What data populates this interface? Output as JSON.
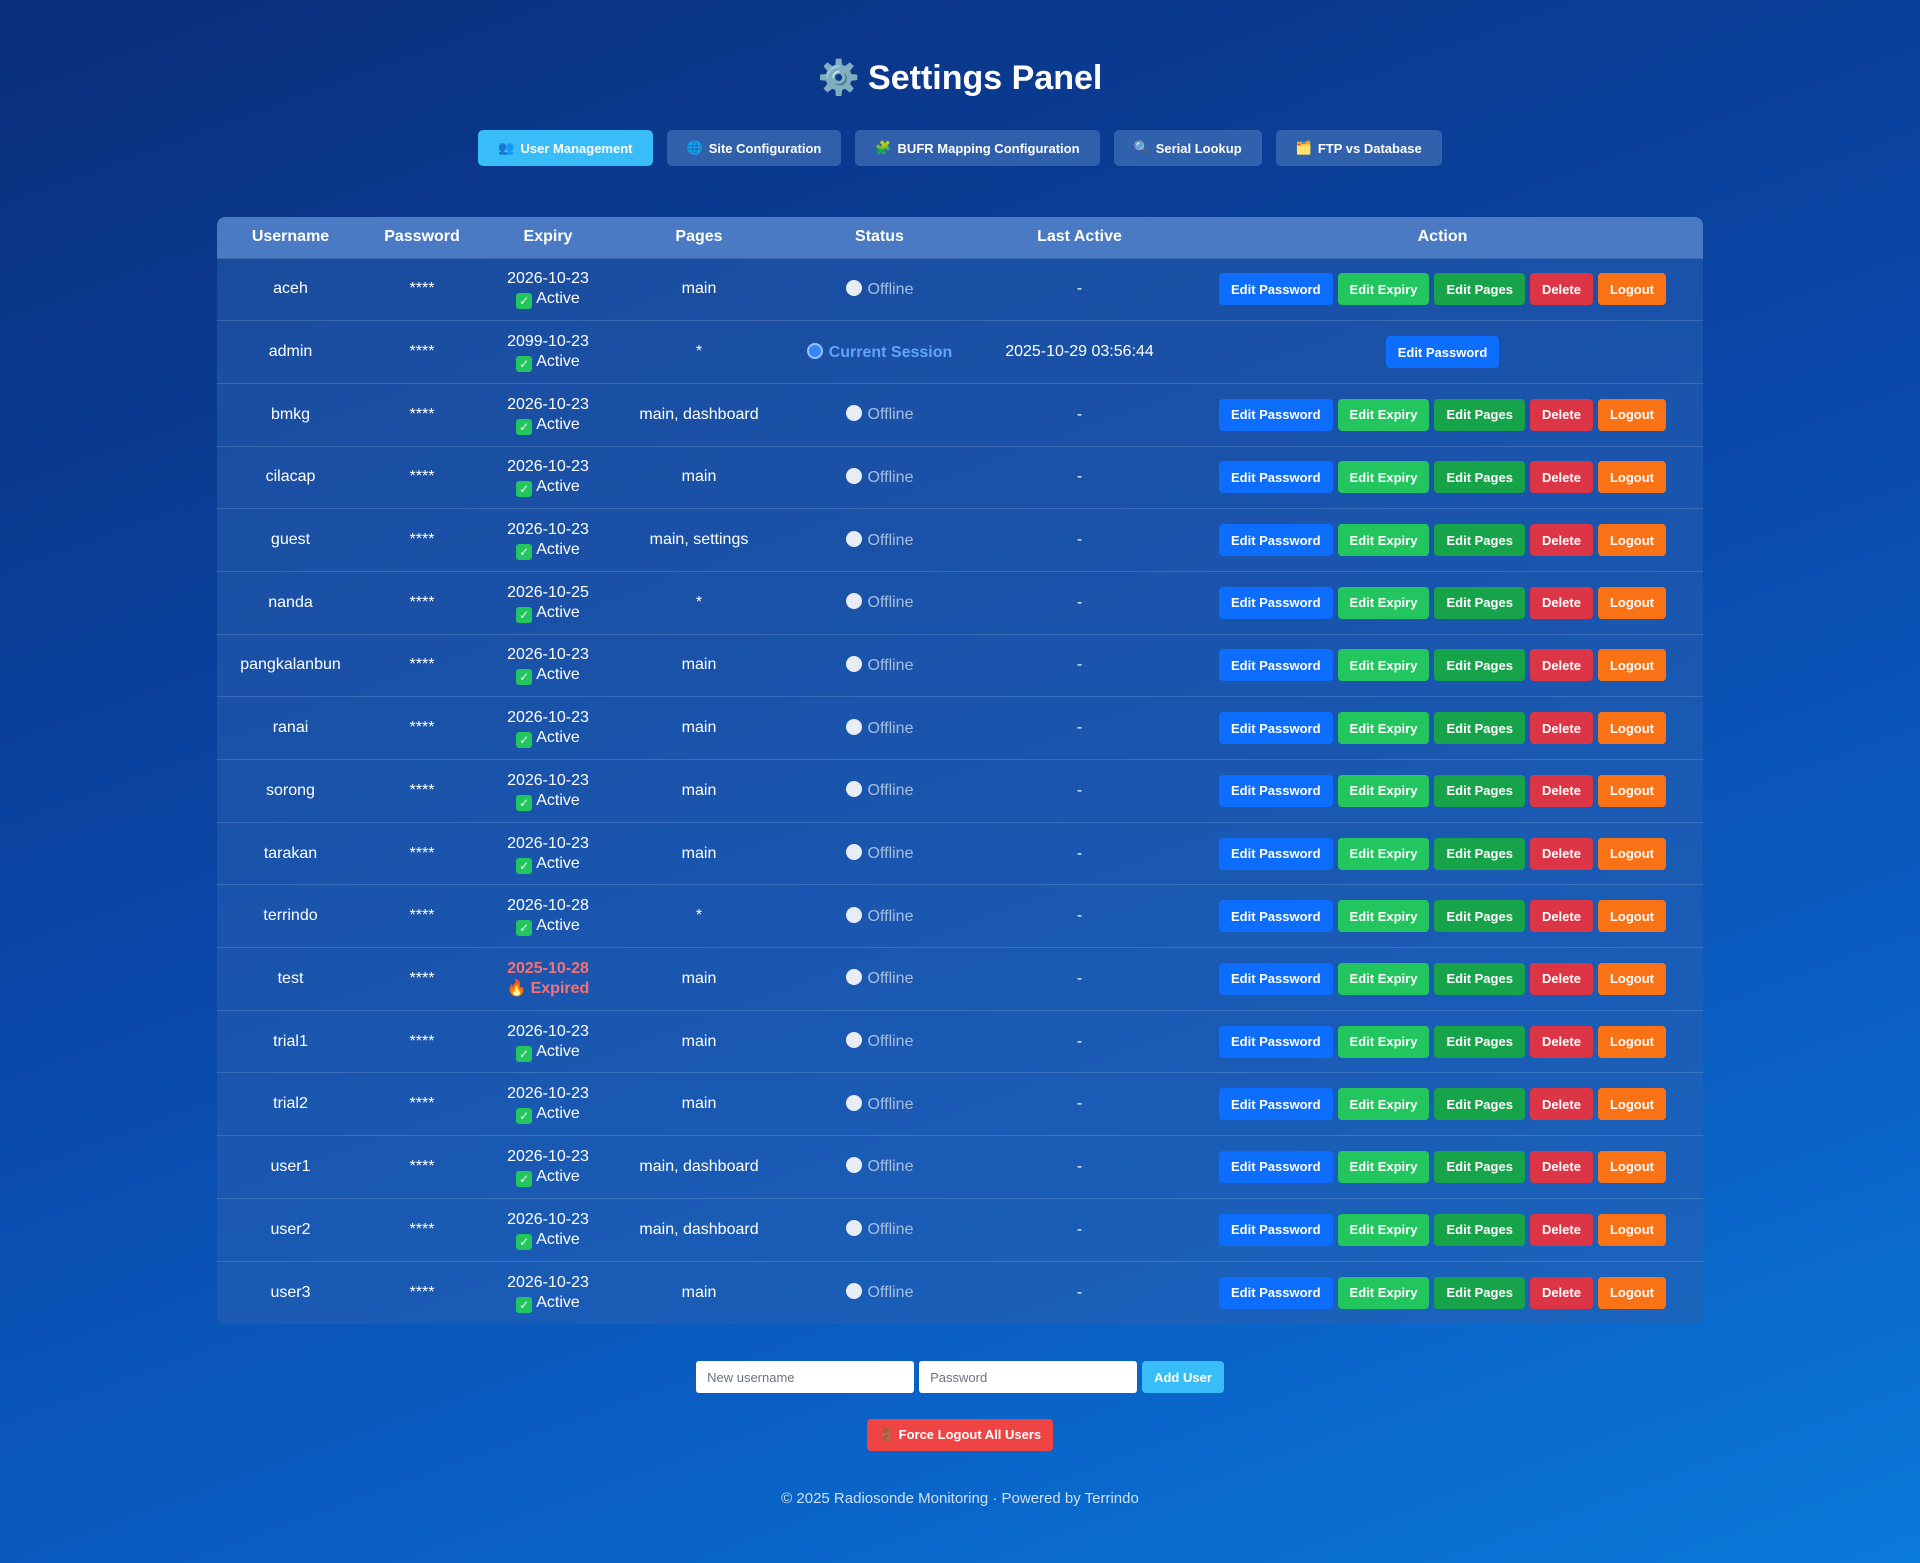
{
  "title": "Settings Panel",
  "title_icon": "gear-icon",
  "tabs": [
    {
      "label": "User Management",
      "icon": "👥",
      "icon_name": "users-icon"
    },
    {
      "label": "Site Configuration",
      "icon": "🌐",
      "icon_name": "globe-icon"
    },
    {
      "label": "BUFR Mapping Configuration",
      "icon": "🧩",
      "icon_name": "puzzle-icon"
    },
    {
      "label": "Serial Lookup",
      "icon": "🔍",
      "icon_name": "search-icon"
    },
    {
      "label": "FTP vs Database",
      "icon": "🗂️",
      "icon_name": "folder-icon"
    }
  ],
  "table": {
    "headers": [
      "Username",
      "Password",
      "Expiry",
      "Pages",
      "Status",
      "Last Active",
      "Action"
    ],
    "rows": [
      {
        "username": "aceh",
        "password": "****",
        "expiry_date": "2026-10-23",
        "expiry_state": "Active",
        "pages": "main",
        "status": "Offline",
        "last_active": "-"
      },
      {
        "username": "admin",
        "password": "****",
        "expiry_date": "2099-10-23",
        "expiry_state": "Active",
        "pages": "*",
        "status": "Current Session",
        "last_active": "2025-10-29 03:56:44",
        "current": true
      },
      {
        "username": "bmkg",
        "password": "****",
        "expiry_date": "2026-10-23",
        "expiry_state": "Active",
        "pages": "main, dashboard",
        "status": "Offline",
        "last_active": "-"
      },
      {
        "username": "cilacap",
        "password": "****",
        "expiry_date": "2026-10-23",
        "expiry_state": "Active",
        "pages": "main",
        "status": "Offline",
        "last_active": "-"
      },
      {
        "username": "guest",
        "password": "****",
        "expiry_date": "2026-10-23",
        "expiry_state": "Active",
        "pages": "main, settings",
        "status": "Offline",
        "last_active": "-"
      },
      {
        "username": "nanda",
        "password": "****",
        "expiry_date": "2026-10-25",
        "expiry_state": "Active",
        "pages": "*",
        "status": "Offline",
        "last_active": "-"
      },
      {
        "username": "pangkalanbun",
        "password": "****",
        "expiry_date": "2026-10-23",
        "expiry_state": "Active",
        "pages": "main",
        "status": "Offline",
        "last_active": "-"
      },
      {
        "username": "ranai",
        "password": "****",
        "expiry_date": "2026-10-23",
        "expiry_state": "Active",
        "pages": "main",
        "status": "Offline",
        "last_active": "-"
      },
      {
        "username": "sorong",
        "password": "****",
        "expiry_date": "2026-10-23",
        "expiry_state": "Active",
        "pages": "main",
        "status": "Offline",
        "last_active": "-"
      },
      {
        "username": "tarakan",
        "password": "****",
        "expiry_date": "2026-10-23",
        "expiry_state": "Active",
        "pages": "main",
        "status": "Offline",
        "last_active": "-"
      },
      {
        "username": "terrindo",
        "password": "****",
        "expiry_date": "2026-10-28",
        "expiry_state": "Active",
        "pages": "*",
        "status": "Offline",
        "last_active": "-"
      },
      {
        "username": "test",
        "password": "****",
        "expiry_date": "2025-10-28",
        "expiry_state": "Expired",
        "pages": "main",
        "status": "Offline",
        "last_active": "-",
        "expired": true
      },
      {
        "username": "trial1",
        "password": "****",
        "expiry_date": "2026-10-23",
        "expiry_state": "Active",
        "pages": "main",
        "status": "Offline",
        "last_active": "-"
      },
      {
        "username": "trial2",
        "password": "****",
        "expiry_date": "2026-10-23",
        "expiry_state": "Active",
        "pages": "main",
        "status": "Offline",
        "last_active": "-"
      },
      {
        "username": "user1",
        "password": "****",
        "expiry_date": "2026-10-23",
        "expiry_state": "Active",
        "pages": "main, dashboard",
        "status": "Offline",
        "last_active": "-"
      },
      {
        "username": "user2",
        "password": "****",
        "expiry_date": "2026-10-23",
        "expiry_state": "Active",
        "pages": "main, dashboard",
        "status": "Offline",
        "last_active": "-"
      },
      {
        "username": "user3",
        "password": "****",
        "expiry_date": "2026-10-23",
        "expiry_state": "Active",
        "pages": "main",
        "status": "Offline",
        "last_active": "-"
      }
    ]
  },
  "actions": {
    "edit_password": "Edit Password",
    "edit_expiry": "Edit Expiry",
    "edit_pages": "Edit Pages",
    "delete": "Delete",
    "logout": "Logout"
  },
  "add_user": {
    "username_placeholder": "New username",
    "password_placeholder": "Password",
    "button_label": "Add User"
  },
  "force_logout": {
    "label": "Force Logout All Users",
    "icon": "🚪",
    "icon_name": "door-icon"
  },
  "footer": "© 2025 Radiosonde Monitoring · Powered by Terrindo",
  "colors": {
    "tab_active": "#38bdf8",
    "edit_password": "#0d6efd",
    "edit_expiry": "#22c55e",
    "edit_pages": "#16a34a",
    "delete": "#dc3545",
    "logout": "#f97316",
    "expired": "#f87171"
  }
}
